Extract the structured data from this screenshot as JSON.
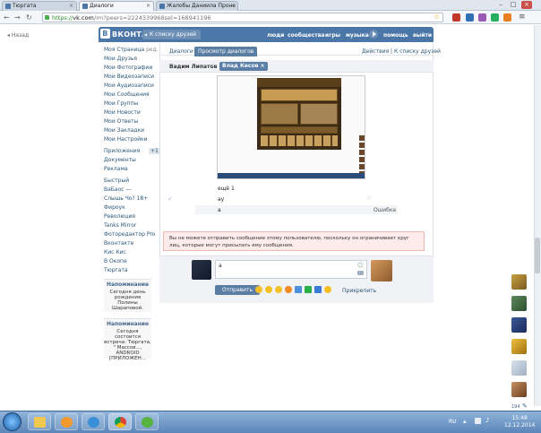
{
  "browser": {
    "tabs": [
      {
        "label": "Тюргата",
        "active": false
      },
      {
        "label": "Диалоги",
        "active": true
      },
      {
        "label": "Жалобы Даниила Проне",
        "active": false
      }
    ],
    "url_scheme": "https://",
    "url_host": "vk.com",
    "url_path": "/im?peers=2224339968sel=168941196"
  },
  "page": {
    "back_label": "Назад"
  },
  "header": {
    "logo": "ВКОНТАКТЕ",
    "logo_badge": "В",
    "back_to_list": "К списку друзей",
    "nav": [
      "люди",
      "сообщества",
      "игры",
      "музыка",
      "помощь",
      "выйти"
    ]
  },
  "menu": {
    "items": [
      "Моя Страница",
      "Мои Друзья",
      "Мои Фотографии",
      "Мои Видеозаписи",
      "Мои Аудиозаписи",
      "Мои Сообщения",
      "Мои Группы",
      "Мои Новости",
      "Мои Ответы",
      "Мои Закладки",
      "Мои Настройки"
    ],
    "edit_label": "ред.",
    "apps": [
      "Приложения",
      "Документы",
      "Реклама"
    ],
    "apps_badge": "+1",
    "groups": [
      "Быстрый",
      "ВаБаос —",
      "Слышь Чо? 18+",
      "Фироук",
      "Революция",
      "Tanks Mirror",
      "Фоторедактор Pro",
      "Вконтакте",
      "Кис Кис",
      "В Окопе",
      "Тюргата"
    ]
  },
  "reminders": [
    {
      "title": "Напоминание",
      "text": "Сегодня день рождения Полины Шараповой."
    },
    {
      "title": "Напоминание",
      "text": "Сегодня состоится встреча: Тюргата, \" Массов..., ANDROID [ПРИЛОЖЕН..."
    }
  ],
  "dialogs": {
    "tab_dialogs": "Диалоги",
    "tab_view": "Просмотр диалогов",
    "actions": "Действия | К списку друзей",
    "peer_me": "Вадим Липатов",
    "peer_other": "Влад Кесов"
  },
  "messages": [
    {
      "text": "ещё 1"
    },
    {
      "text": "ау"
    },
    {
      "text": "а",
      "status": "Ошибка"
    }
  ],
  "warning": "Вы не можете отправить сообщение этому пользователю, поскольку он ограничивает круг лиц, которые могут присылать ему сообщения.",
  "composer": {
    "input_value": "а",
    "send_label": "Отправить",
    "attach_label": "Прикрепить",
    "emoji_colors": [
      "#f5c026",
      "#f5c026",
      "#f5c026",
      "#f08a24",
      "#4a90d9",
      "#2bb14a",
      "#3a7bd5",
      "#f5c026"
    ]
  },
  "right_panel": {
    "counter": "194"
  },
  "taskbar": {
    "lang": "RU",
    "time": "15:48",
    "date": "12.12.2014"
  },
  "colors": {
    "vk_blue": "#4a76a8",
    "link": "#2b587a",
    "error_bg": "#fdecea"
  }
}
